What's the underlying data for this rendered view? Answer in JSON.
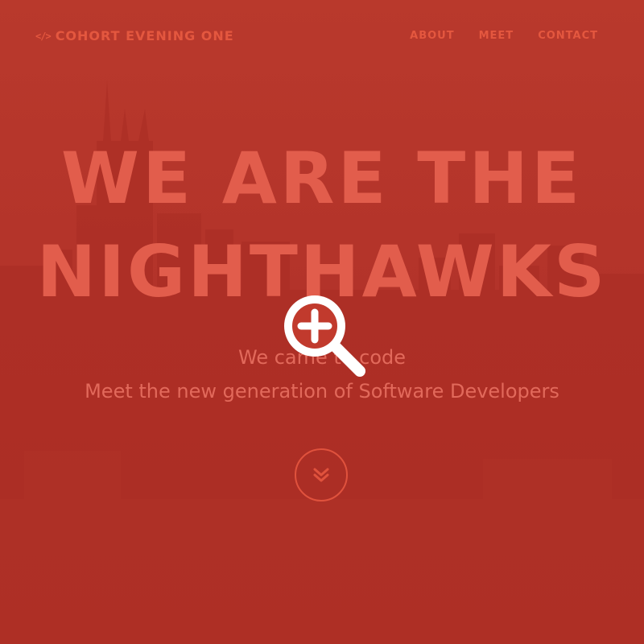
{
  "theme": {
    "background": "#b7352a",
    "accent": "#e4573f",
    "headline_color": "#e25d4c",
    "subtitle_color": "#e2695b"
  },
  "nav": {
    "brand_icon": "code-icon",
    "brand_icon_glyph": "</>",
    "brand_label": "COHORT EVENING ONE",
    "links": [
      {
        "label": "ABOUT"
      },
      {
        "label": "MEET"
      },
      {
        "label": "CONTACT"
      }
    ]
  },
  "hero": {
    "headline_line1": "WE ARE THE",
    "headline_line2": "NIGHTHAWKS",
    "subtitle_line1": "We came to code",
    "subtitle_line2": "Meet the new generation of Software Developers",
    "scroll_icon": "double-chevron-down-icon"
  },
  "overlay": {
    "icon": "zoom-in-icon"
  }
}
